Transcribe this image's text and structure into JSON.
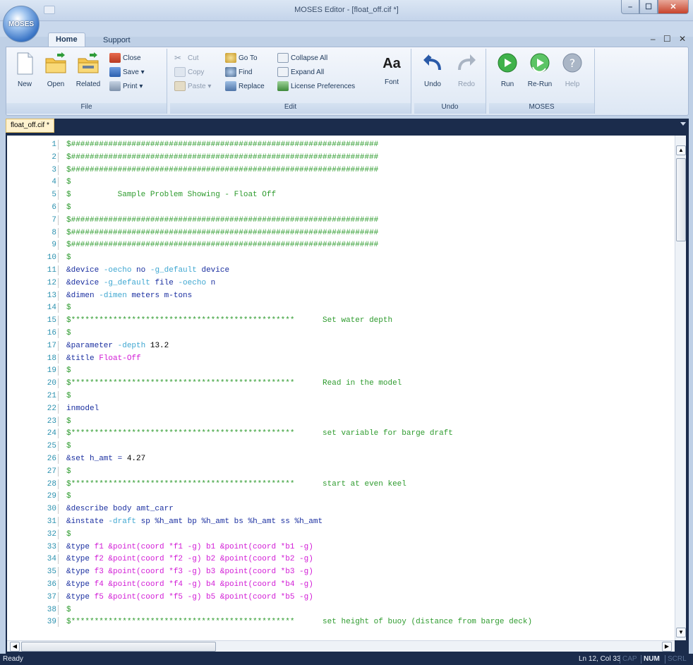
{
  "window": {
    "title": "MOSES Editor - [float_off.cif *]",
    "app_orb_label": "MOSES"
  },
  "ribbon": {
    "tabs": [
      "Home",
      "Support"
    ],
    "mdi_controls": "– ☐ ✕",
    "groups": {
      "file": {
        "label": "File",
        "new": "New",
        "open": "Open",
        "related": "Related",
        "close": "Close",
        "save": "Save ▾",
        "print": "Print ▾"
      },
      "edit": {
        "label": "Edit",
        "cut": "Cut",
        "copy": "Copy",
        "paste": "Paste ▾",
        "goto": "Go To",
        "find": "Find",
        "replace": "Replace",
        "collapse_all": "Collapse All",
        "expand_all": "Expand All",
        "license_prefs": "License Preferences",
        "font_glyph": "Aa",
        "font": "Font"
      },
      "undo": {
        "label": "Undo",
        "undo": "Undo",
        "redo": "Redo"
      },
      "moses": {
        "label": "MOSES",
        "run": "Run",
        "rerun": "Re-Run",
        "help": "Help"
      }
    }
  },
  "document": {
    "tab": "float_off.cif *"
  },
  "editor": {
    "lines": [
      {
        "n": "1",
        "segs": [
          [
            "c-cmt",
            "$##################################################################"
          ]
        ]
      },
      {
        "n": "2",
        "segs": [
          [
            "c-cmt",
            "$##################################################################"
          ]
        ]
      },
      {
        "n": "3",
        "segs": [
          [
            "c-cmt",
            "$##################################################################"
          ]
        ]
      },
      {
        "n": "4",
        "segs": [
          [
            "c-cmt",
            "$"
          ]
        ]
      },
      {
        "n": "5",
        "segs": [
          [
            "c-cmt",
            "$          Sample Problem Showing - Float Off"
          ]
        ]
      },
      {
        "n": "6",
        "segs": [
          [
            "c-cmt",
            "$"
          ]
        ]
      },
      {
        "n": "7",
        "segs": [
          [
            "c-cmt",
            "$##################################################################"
          ]
        ]
      },
      {
        "n": "8",
        "segs": [
          [
            "c-cmt",
            "$##################################################################"
          ]
        ]
      },
      {
        "n": "9",
        "segs": [
          [
            "c-cmt",
            "$##################################################################"
          ]
        ]
      },
      {
        "n": "10",
        "segs": [
          [
            "c-cmt",
            "$"
          ]
        ]
      },
      {
        "n": "11",
        "segs": [
          [
            "c-kw",
            "&device "
          ],
          [
            "c-opt",
            "-oecho "
          ],
          [
            "c-kw",
            "no "
          ],
          [
            "c-opt",
            "-g_default "
          ],
          [
            "c-kw",
            "device"
          ]
        ]
      },
      {
        "n": "12",
        "segs": [
          [
            "c-kw",
            "&device "
          ],
          [
            "c-opt",
            "-g_default "
          ],
          [
            "c-kw",
            "file "
          ],
          [
            "c-opt",
            "-oecho "
          ],
          [
            "c-kw",
            "n"
          ]
        ]
      },
      {
        "n": "13",
        "segs": [
          [
            "c-kw",
            "&dimen "
          ],
          [
            "c-opt",
            "-dimen "
          ],
          [
            "c-kw",
            "meters m-tons"
          ]
        ]
      },
      {
        "n": "14",
        "segs": [
          [
            "c-cmt",
            "$"
          ]
        ]
      },
      {
        "n": "15",
        "segs": [
          [
            "c-cmt",
            "$************************************************      Set water depth"
          ]
        ]
      },
      {
        "n": "16",
        "segs": [
          [
            "c-cmt",
            "$"
          ]
        ]
      },
      {
        "n": "17",
        "segs": [
          [
            "c-kw",
            "&parameter "
          ],
          [
            "c-opt",
            "-depth "
          ],
          [
            "c-val",
            "13.2"
          ]
        ]
      },
      {
        "n": "18",
        "segs": [
          [
            "c-kw",
            "&title "
          ],
          [
            "c-str",
            "Float-Off"
          ]
        ]
      },
      {
        "n": "19",
        "segs": [
          [
            "c-cmt",
            "$"
          ]
        ]
      },
      {
        "n": "20",
        "segs": [
          [
            "c-cmt",
            "$************************************************      Read in the model"
          ]
        ]
      },
      {
        "n": "21",
        "segs": [
          [
            "c-cmt",
            "$"
          ]
        ]
      },
      {
        "n": "22",
        "segs": [
          [
            "c-kw",
            "inmodel"
          ]
        ]
      },
      {
        "n": "23",
        "segs": [
          [
            "c-cmt",
            "$"
          ]
        ]
      },
      {
        "n": "24",
        "segs": [
          [
            "c-cmt",
            "$************************************************      set variable for barge draft"
          ]
        ]
      },
      {
        "n": "25",
        "segs": [
          [
            "c-cmt",
            "$"
          ]
        ]
      },
      {
        "n": "26",
        "segs": [
          [
            "c-kw",
            "&set h_amt = "
          ],
          [
            "c-val",
            "4.27"
          ]
        ]
      },
      {
        "n": "27",
        "segs": [
          [
            "c-cmt",
            "$"
          ]
        ]
      },
      {
        "n": "28",
        "segs": [
          [
            "c-cmt",
            "$************************************************      start at even keel"
          ]
        ]
      },
      {
        "n": "29",
        "segs": [
          [
            "c-cmt",
            "$"
          ]
        ]
      },
      {
        "n": "30",
        "segs": [
          [
            "c-kw",
            "&describe body amt_carr"
          ]
        ]
      },
      {
        "n": "31",
        "segs": [
          [
            "c-kw",
            "&instate "
          ],
          [
            "c-opt",
            "-draft "
          ],
          [
            "c-kw",
            "sp %h_amt bp %h_amt bs %h_amt ss %h_amt"
          ]
        ]
      },
      {
        "n": "32",
        "segs": [
          [
            "c-cmt",
            "$"
          ]
        ]
      },
      {
        "n": "33",
        "segs": [
          [
            "c-kw",
            "&type "
          ],
          [
            "c-str",
            "f1 &point(coord *f1 -g) b1 &point(coord *b1 -g)"
          ]
        ]
      },
      {
        "n": "34",
        "segs": [
          [
            "c-kw",
            "&type "
          ],
          [
            "c-str",
            "f2 &point(coord *f2 -g) b2 &point(coord *b2 -g)"
          ]
        ]
      },
      {
        "n": "35",
        "segs": [
          [
            "c-kw",
            "&type "
          ],
          [
            "c-str",
            "f3 &point(coord *f3 -g) b3 &point(coord *b3 -g)"
          ]
        ]
      },
      {
        "n": "36",
        "segs": [
          [
            "c-kw",
            "&type "
          ],
          [
            "c-str",
            "f4 &point(coord *f4 -g) b4 &point(coord *b4 -g)"
          ]
        ]
      },
      {
        "n": "37",
        "segs": [
          [
            "c-kw",
            "&type "
          ],
          [
            "c-str",
            "f5 &point(coord *f5 -g) b5 &point(coord *b5 -g)"
          ]
        ]
      },
      {
        "n": "38",
        "segs": [
          [
            "c-cmt",
            "$"
          ]
        ]
      },
      {
        "n": "39",
        "segs": [
          [
            "c-cmt",
            "$************************************************      set height of buoy (distance from barge deck)"
          ]
        ]
      }
    ]
  },
  "statusbar": {
    "ready": "Ready",
    "position": "Ln 12, Col 33",
    "cap": "CAP",
    "num": "NUM",
    "scrl": "SCRL"
  },
  "colors": {
    "comment": "#2e9b2e",
    "keyword": "#1a2fa0",
    "option": "#3fa7d1",
    "string": "#d21bd6",
    "line_number": "#2b91af",
    "chrome_dark": "#1b2c4c"
  }
}
